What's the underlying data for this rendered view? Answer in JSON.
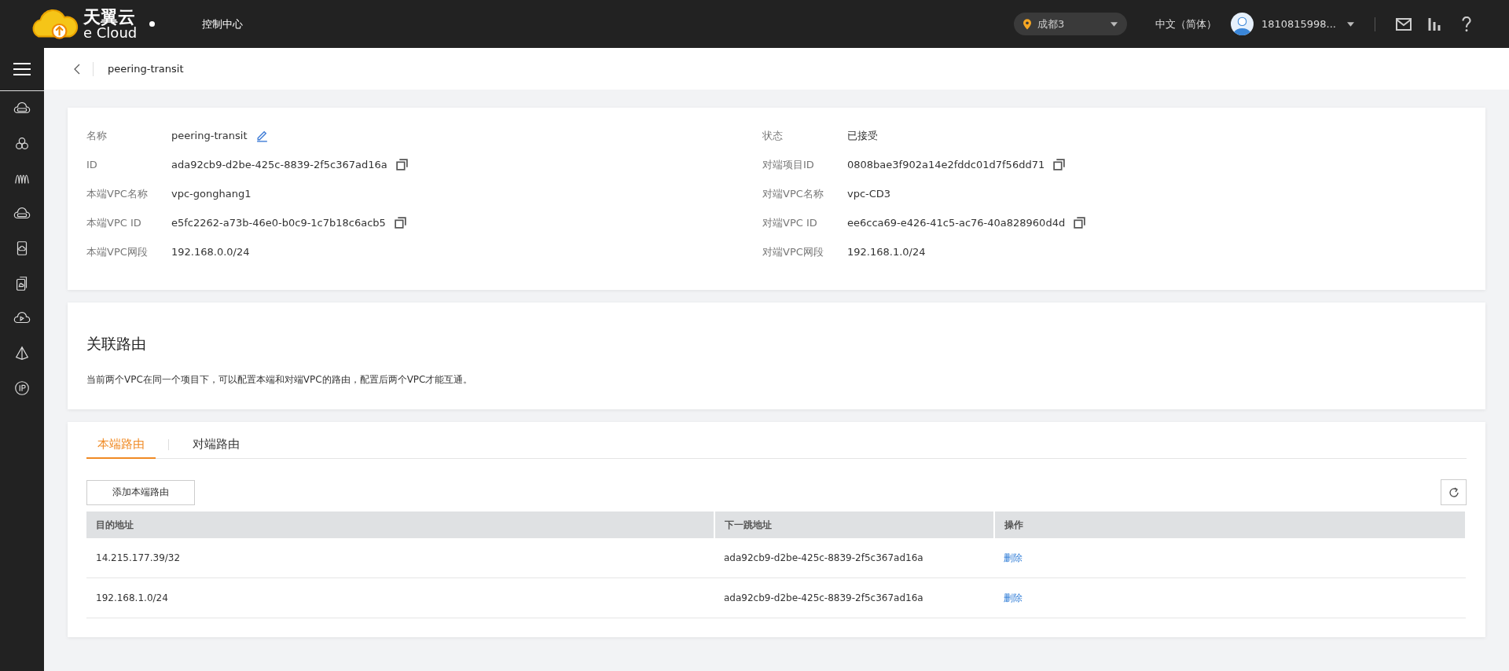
{
  "topbar": {
    "logo": {
      "name": "天翼云",
      "sub": "e Cloud"
    },
    "nav_title": "控制中心",
    "region": "成都3",
    "language": "中文（简体）",
    "user": "1810815998..."
  },
  "sidebar": {
    "items": [
      {
        "kind": "server"
      },
      {
        "kind": "cluster"
      },
      {
        "kind": "waves"
      },
      {
        "kind": "disk"
      },
      {
        "kind": "card"
      },
      {
        "kind": "cards"
      },
      {
        "kind": "play"
      },
      {
        "kind": "pyramid"
      },
      {
        "kind": "ip"
      }
    ]
  },
  "breadcrumb": {
    "title": "peering-transit"
  },
  "details": {
    "left": [
      {
        "label": "名称",
        "value": "peering-transit",
        "kind": "edit"
      },
      {
        "label": "ID",
        "value": "ada92cb9-d2be-425c-8839-2f5c367ad16a",
        "kind": "copy"
      },
      {
        "label": "本端VPC名称",
        "value": "vpc-gonghang1"
      },
      {
        "label": "本端VPC ID",
        "value": "e5fc2262-a73b-46e0-b0c9-1c7b18c6acb5",
        "kind": "copy"
      },
      {
        "label": "本端VPC网段",
        "value": "192.168.0.0/24"
      }
    ],
    "right": [
      {
        "label": "状态",
        "value": "已接受"
      },
      {
        "label": "对端项目ID",
        "value": "0808bae3f902a14e2fddc01d7f56dd71",
        "kind": "copy"
      },
      {
        "label": "对端VPC名称",
        "value": "vpc-CD3"
      },
      {
        "label": "对端VPC ID",
        "value": "ee6cca69-e426-41c5-ac76-40a828960d4d",
        "kind": "copy"
      },
      {
        "label": "对端VPC网段",
        "value": "192.168.1.0/24"
      }
    ]
  },
  "routes_info": {
    "title": "关联路由",
    "description": "当前两个VPC在同一个项目下，可以配置本端和对端VPC的路由，配置后两个VPC才能互通。"
  },
  "tabs": [
    {
      "label": "本端路由",
      "selected": true
    },
    {
      "label": "对端路由",
      "selected": false
    }
  ],
  "add_button": "添加本端路由",
  "table": {
    "columns": [
      "目的地址",
      "下一跳地址",
      "操作"
    ],
    "rows": [
      {
        "destination": "14.215.177.39/32",
        "next_hop": "ada92cb9-d2be-425c-8839-2f5c367ad16a",
        "action": "删除"
      },
      {
        "destination": "192.168.1.0/24",
        "next_hop": "ada92cb9-d2be-425c-8839-2f5c367ad16a",
        "action": "删除"
      }
    ]
  }
}
